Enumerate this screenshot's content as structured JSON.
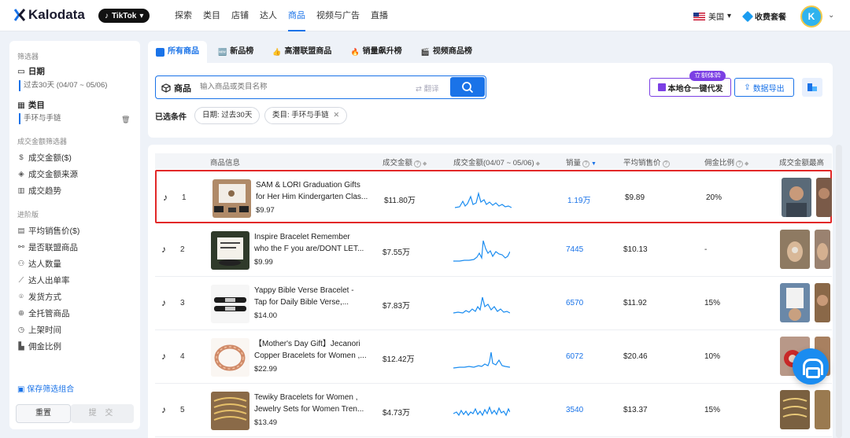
{
  "brand": {
    "name": "Kalodata"
  },
  "platform": {
    "label": "TikTok"
  },
  "nav": [
    "探索",
    "类目",
    "店铺",
    "达人",
    "商品",
    "视频与广告",
    "直播"
  ],
  "nav_active": "商品",
  "region": "美国",
  "plans": "收费套餐",
  "avatar_letter": "K",
  "sidebar": {
    "filter_title": "筛选器",
    "date_label": "日期",
    "date_value": "过去30天 (04/07 ~ 05/06)",
    "category_label": "类目",
    "category_value": "手环与手链",
    "gmv_section": "成交金额筛选器",
    "gmv_items": [
      "成交金额($)",
      "成交金额来源",
      "成交趋势"
    ],
    "advanced_section": "进阶版",
    "advanced_items": [
      "平均销售价($)",
      "是否联盟商品",
      "达人数量",
      "达人出单率",
      "发货方式",
      "全托管商品",
      "上架时间",
      "佣金比例"
    ],
    "save_combo": "保存筛选组合",
    "reset": "重置",
    "submit": "提 交"
  },
  "tabs": [
    "所有商品",
    "新品榜",
    "高潜联盟商品",
    "销量飙升榜",
    "视频商品榜"
  ],
  "search": {
    "label": "商品",
    "placeholder": "输入商品或类目名称",
    "translate": "翻译"
  },
  "actions": {
    "oneclick": "本地仓一键代发",
    "try_badge": "立刻体验",
    "export": "数据导出"
  },
  "conditions": {
    "label": "已选条件",
    "chips": [
      "日期: 过去30天",
      "类目: 手环与手链"
    ]
  },
  "columns": [
    "商品信息",
    "成交金额",
    "成交金额(04/07 ~ 05/06)",
    "销量",
    "平均销售价",
    "佣金比例",
    "成交金额最高"
  ],
  "rows": [
    {
      "rank": "1",
      "name1": "SAM & LORI Graduation Gifts",
      "name2": "for Her Him Kindergarten Clas...",
      "price": "$9.97",
      "revenue": "$11.80万",
      "sales": "1.19万",
      "avg_price": "$9.89",
      "commission": "20%"
    },
    {
      "rank": "2",
      "name1": "Inspire Bracelet Remember",
      "name2": "who the F you are/DONT LET...",
      "price": "$9.99",
      "revenue": "$7.55万",
      "sales": "7445",
      "avg_price": "$10.13",
      "commission": "-"
    },
    {
      "rank": "3",
      "name1": "Yappy Bible Verse Bracelet -",
      "name2": "Tap for Daily Bible Verse,...",
      "price": "$14.00",
      "revenue": "$7.83万",
      "sales": "6570",
      "avg_price": "$11.92",
      "commission": "15%"
    },
    {
      "rank": "4",
      "name1": "【Mother's Day Gift】Jecanori",
      "name2": "Copper Bracelets for Women ,...",
      "price": "$22.99",
      "revenue": "$12.42万",
      "sales": "6072",
      "avg_price": "$20.46",
      "commission": "10%"
    },
    {
      "rank": "5",
      "name1": "Tewiky Bracelets for Women ,",
      "name2": "Jewelry Sets for Women Tren...",
      "price": "$13.49",
      "revenue": "$4.73万",
      "sales": "3540",
      "avg_price": "$13.37",
      "commission": "15%"
    }
  ],
  "colors": {
    "accent": "#1a73e8",
    "highlight": "#e22828",
    "purple": "#7b3fe4"
  }
}
